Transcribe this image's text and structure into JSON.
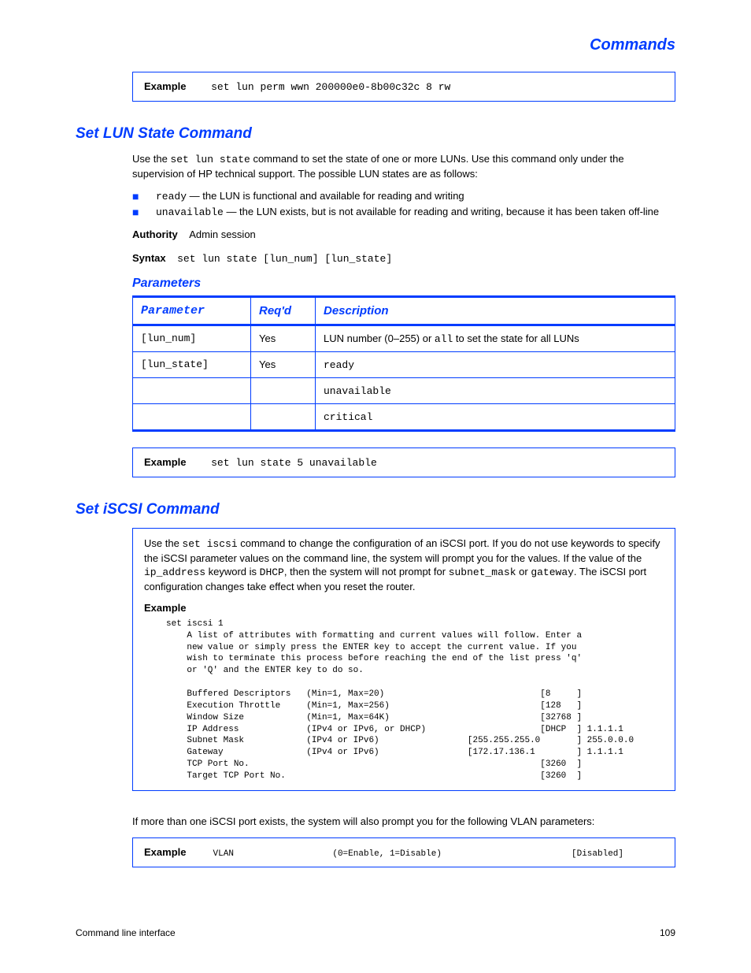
{
  "header_right": "Commands",
  "example1": {
    "label": "Example",
    "text": "set lun perm wwn 200000e0-8b00c32c 8 rw"
  },
  "cmd_heading": "Set LUN State Command",
  "cmd_intro_1": "Use the ",
  "cmd_intro_mono": "set lun state",
  "cmd_intro_2": " command to set the state of one or more LUNs. Use this command only under the supervision of HP technical support. The possible LUN states are as follows:",
  "states": [
    {
      "mono": "ready",
      "rest": " — the LUN is functional and available for reading and writing"
    },
    {
      "mono": "unavailable",
      "rest": " — the LUN exists, but is not available for reading and writing, because it has been taken off-line"
    }
  ],
  "cmd_auth": "Authority",
  "cmd_auth_val": "Admin session",
  "cmd_syntax": "Syntax",
  "cmd_syntax_mono": "set lun state [lun_num] [lun_state]",
  "table_caption": "Parameters",
  "table": {
    "headers": [
      "Parameter",
      "Req'd",
      "Description"
    ],
    "rows": [
      {
        "p": "[lun_num]",
        "r": "Yes",
        "d_pre": "LUN number (0–255) or ",
        "d_mono": "all",
        "d_post": " to set the state for all LUNs"
      },
      {
        "p": "[lun_state]",
        "r": "Yes",
        "d_pre": "",
        "d_mono": "ready",
        "d_post": ""
      },
      {
        "p": "",
        "r": "",
        "d_pre": "",
        "d_mono": "unavailable",
        "d_post": ""
      },
      {
        "p": "",
        "r": "",
        "d_pre": "",
        "d_mono": "critical",
        "d_post": ""
      }
    ]
  },
  "example2": {
    "label": "Example",
    "text": "set lun state 5 unavailable"
  },
  "iscsi_heading": "Set iSCSI Command",
  "iscsi_intro_1": "Use the ",
  "iscsi_intro_mono1": "set iscsi",
  "iscsi_intro_2": " command to change the configuration of an iSCSI port. If you do not use keywords to specify the iSCSI parameter values on the command line, the system will prompt you for the values. If the value of the ",
  "iscsi_intro_mono2": "ip_address",
  "iscsi_intro_3": " keyword is ",
  "iscsi_intro_mono3": "DHCP",
  "iscsi_intro_4": ", then the system will not prompt for ",
  "iscsi_intro_mono4": "subnet_mask",
  "iscsi_intro_5": " or ",
  "iscsi_intro_mono5": "gateway",
  "iscsi_intro_6": ". The iSCSI port configuration changes take effect when you reset the router.",
  "ex3_label": "Example",
  "ex3_lines": [
    "set iscsi 1",
    "    A list of attributes with formatting and current values will follow. Enter a",
    "    new value or simply press the ENTER key to accept the current value. If you",
    "    wish to terminate this process before reaching the end of the list press 'q'",
    "    or 'Q' and the ENTER key to do so.",
    "",
    "    Buffered Descriptors   (Min=1, Max=20)                              [8     ]",
    "    Execution Throttle     (Min=1, Max=256)                             [128   ]",
    "    Window Size            (Min=1, Max=64K)                             [32768 ]",
    "    IP Address             (IPv4 or IPv6, or DHCP)                      [DHCP  ] 1.1.1.1",
    "    Subnet Mask            (IPv4 or IPv6)                 [255.255.255.0       ] 255.0.0.0",
    "    Gateway                (IPv4 or IPv6)                 [172.17.136.1        ] 1.1.1.1",
    "    TCP Port No.                                                        [3260  ]",
    "    Target TCP Port No.                                                 [3260  ]"
  ],
  "continue_note": "If more than one iSCSI port exists, the system will also prompt you for the following VLAN parameters:",
  "ex4_label": "Example",
  "ex4_line": "    VLAN                   (0=Enable, 1=Disable)                         [Disabled]",
  "footer_left": "Command line interface",
  "footer_right": "109"
}
